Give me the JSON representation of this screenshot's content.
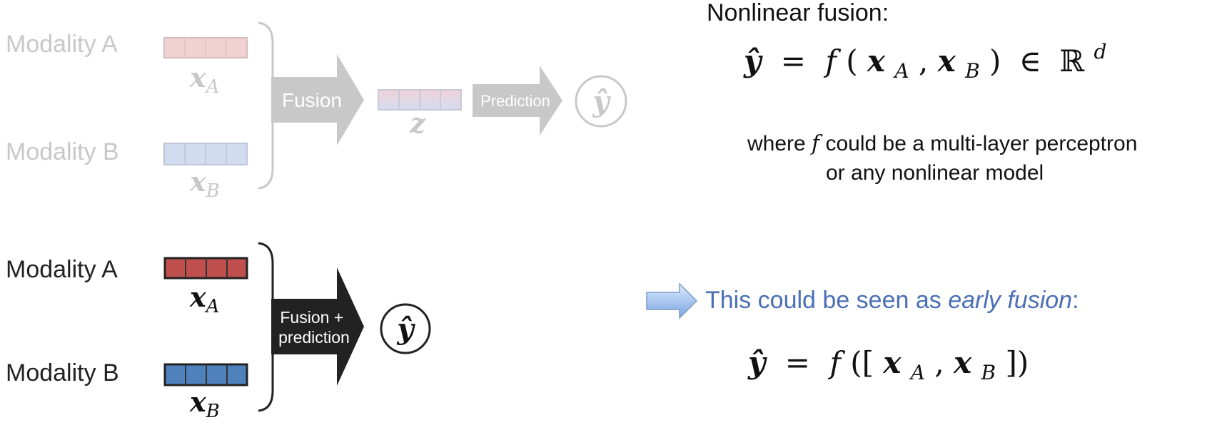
{
  "top": {
    "modality_a": "Modality A",
    "modality_b": "Modality B",
    "var_a": "x",
    "var_a_sub": "A",
    "var_b": "x",
    "var_b_sub": "B",
    "fusion_label": "Fusion",
    "z_label": "z",
    "prediction_label": "Prediction",
    "output": "ŷ",
    "colors": {
      "a_cells": "#f0d2d2",
      "b_cells": "#d2dcf0",
      "grey": "#c8c8c8"
    }
  },
  "bottom": {
    "modality_a": "Modality A",
    "modality_b": "Modality B",
    "var_a": "x",
    "var_a_sub": "A",
    "var_b": "x",
    "var_b_sub": "B",
    "fusion_label_line1": "Fusion +",
    "fusion_label_line2": "prediction",
    "output": "ŷ",
    "colors": {
      "a_cells": "#c0504d",
      "b_cells": "#4f81bd",
      "arrow": "#222222"
    }
  },
  "right": {
    "heading": "Nonlinear fusion:",
    "eq1": {
      "lhs": "ŷ",
      "eq": "=",
      "f": "f",
      "open": "(",
      "xa": "x",
      "xa_sub": "A",
      "comma": ",",
      "xb": "x",
      "xb_sub": "B",
      "close": ")",
      "in": "∈",
      "R": "ℝ",
      "sup": "d"
    },
    "note_line1_pre": "where ",
    "note_f": "f",
    "note_line1_post": " could be a multi-layer perceptron",
    "note_line2": "or any nonlinear model",
    "statement_pre": "This could be seen as ",
    "statement_em": "early fusion",
    "statement_post": ":",
    "eq2": {
      "lhs": "ŷ",
      "eq": "=",
      "f": "f",
      "open": "([",
      "xa": "x",
      "xa_sub": "A",
      "comma": ",",
      "xb": "x",
      "xb_sub": "B",
      "close": "])"
    },
    "colors": {
      "statement": "#4a6fb5",
      "arrow_fill": "#9ec3f0"
    }
  }
}
